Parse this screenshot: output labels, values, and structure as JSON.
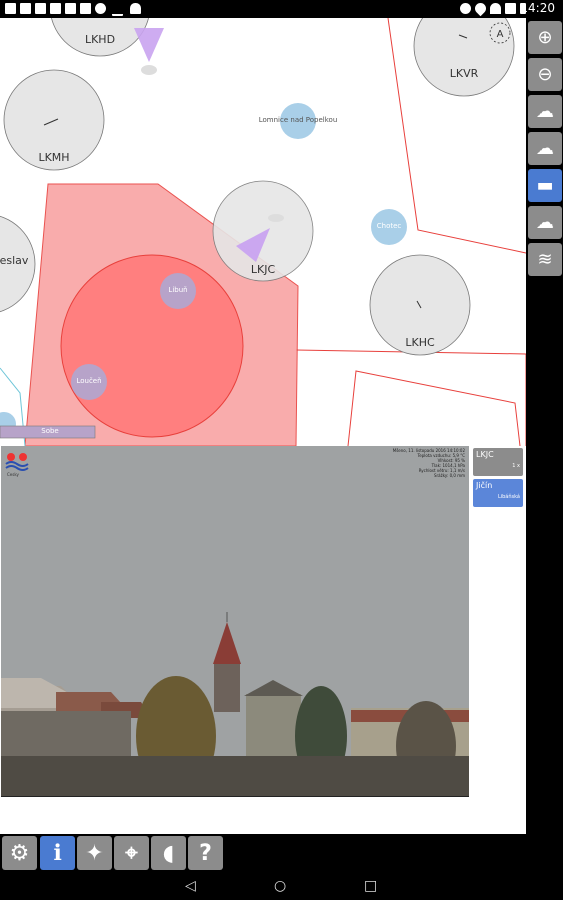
{
  "status_bar": {
    "time": "14:20",
    "left_icons": [
      "facebook-icon",
      "image-icon",
      "hd-icon",
      "sim-icon",
      "gallery-icon",
      "camera-icon",
      "data-saver-icon",
      "activity-icon",
      "android-icon"
    ],
    "right_icons": [
      "vibrate-icon",
      "location-icon",
      "wifi-icon",
      "no-sim-icon",
      "battery-icon"
    ]
  },
  "map": {
    "airports": [
      {
        "id": "lkhd",
        "label": "LKHD"
      },
      {
        "id": "lkmh",
        "label": "LKMH"
      },
      {
        "id": "lkvr",
        "label": "LKVR"
      },
      {
        "id": "lkjc",
        "label": "LKJC"
      },
      {
        "id": "lkhc",
        "label": "LKHC"
      },
      {
        "id": "mnichovo-hradiste",
        "label": "eslav"
      }
    ],
    "towns": [
      {
        "id": "lomnice",
        "label": "Lomnice nad Popelkou"
      },
      {
        "id": "chotec",
        "label": "Chotec"
      },
      {
        "id": "libun",
        "label": "Libuň"
      },
      {
        "id": "loucen",
        "label": "Loučeň"
      }
    ],
    "bottom_label": "Sobe",
    "colors": {
      "airport_circle": "#e6e6e6",
      "restricted_area": "#f9a4a4",
      "danger_zone": "#ff7f7f",
      "town_bubble": "#a9cfe8",
      "webcam_marker": "#c9a3f0",
      "border_line": "#e8403c"
    }
  },
  "right_toolbar": {
    "buttons": [
      {
        "name": "zoom-in-button",
        "icon": "zoom-in-icon",
        "glyph": "⊕",
        "active": false
      },
      {
        "name": "zoom-out-button",
        "icon": "zoom-out-icon",
        "glyph": "⊖",
        "active": false
      },
      {
        "name": "weather-rain-button",
        "icon": "rain-cloud-icon",
        "glyph": "☁",
        "active": false
      },
      {
        "name": "weather-lightning-button",
        "icon": "storm-cloud-icon",
        "glyph": "☁",
        "active": false
      },
      {
        "name": "webcam-layer-button",
        "icon": "webcam-icon",
        "glyph": "▬",
        "active": true
      },
      {
        "name": "clouds-layer-button",
        "icon": "cloud-icon",
        "glyph": "☁",
        "active": false
      },
      {
        "name": "wind-layer-button",
        "icon": "wind-icon",
        "glyph": "≋",
        "active": false
      }
    ]
  },
  "webcam": {
    "overlay_lines": [
      "Mšeno, 11. listopadu 2016 14:10:02",
      "Teplota vzduchu: 5,9 °C",
      "Vlhkost: 95 %",
      "Tlak: 1014,1 hPa",
      "Rychlost větru: 1,1 m/s",
      "Srážky: 0,0 mm"
    ],
    "logo_text": "Cesky",
    "list": [
      {
        "code": "LKJC",
        "sub": "1 x",
        "active": false
      },
      {
        "code": "Jičín",
        "sub": "Libáňská",
        "active": true
      }
    ]
  },
  "bottom_toolbar": {
    "buttons": [
      {
        "name": "settings-button",
        "icon": "gear-icon",
        "glyph": "⚙",
        "active": false
      },
      {
        "name": "info-button",
        "icon": "info-icon",
        "glyph": "ℹ",
        "active": true
      },
      {
        "name": "compass-button",
        "icon": "compass-icon",
        "glyph": "✦",
        "active": false
      },
      {
        "name": "gps-button",
        "icon": "crosshair-icon",
        "glyph": "⌖",
        "active": false
      },
      {
        "name": "radio-button",
        "icon": "radio-icon",
        "glyph": "◖",
        "active": false
      },
      {
        "name": "help-button",
        "icon": "help-icon",
        "glyph": "?",
        "active": false
      }
    ]
  },
  "nav_bar": {
    "back": "◁",
    "home": "○",
    "recents": "□"
  }
}
